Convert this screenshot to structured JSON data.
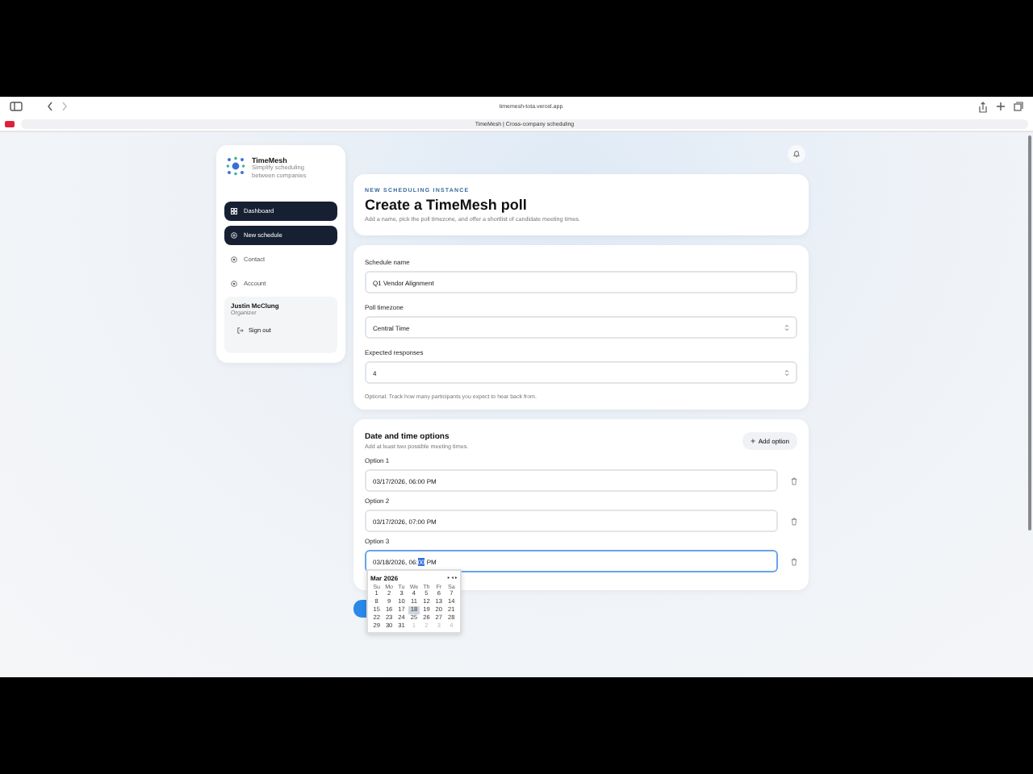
{
  "browser": {
    "url": "timemesh-tota.vercel.app",
    "tab_title": "TimeMesh | Cross-company scheduling"
  },
  "sidebar": {
    "brand": "TimeMesh",
    "tagline": "Simplify scheduling between companies",
    "items": [
      {
        "label": "Dashboard",
        "selected": true,
        "kind": "grid"
      },
      {
        "label": "New schedule",
        "selected": true,
        "kind": "plus"
      },
      {
        "label": "Contact",
        "selected": false,
        "kind": "circle"
      },
      {
        "label": "Account",
        "selected": false,
        "kind": "circle"
      }
    ],
    "user": {
      "name": "Justin McClung",
      "role": "Organizer",
      "sign_out": "Sign out"
    }
  },
  "header": {
    "eyebrow": "NEW SCHEDULING INSTANCE",
    "title": "Create a TimeMesh poll",
    "description": "Add a name, pick the poll timezone, and offer a shortlist of candidate meeting times."
  },
  "form": {
    "fields": [
      {
        "label": "Schedule name",
        "value": "Q1 Vendor Alignment",
        "kind": "text"
      },
      {
        "label": "Poll timezone",
        "value": "Central Time",
        "kind": "select"
      },
      {
        "label": "Expected responses",
        "value": "4",
        "kind": "number"
      }
    ],
    "hint": "Optional. Track how many participants you expect to hear back from."
  },
  "dates": {
    "title": "Date and time options",
    "subtitle": "Add at least two possible meeting times.",
    "add_label": "Add option",
    "options": [
      {
        "label": "Option 1",
        "focused": false,
        "segments": [
          {
            "text": "03/17/2026, 06:00 PM",
            "selected": false
          }
        ]
      },
      {
        "label": "Option 2",
        "focused": false,
        "segments": [
          {
            "text": "03/17/2026, 07:00 PM",
            "selected": false
          }
        ]
      },
      {
        "label": "Option 3",
        "focused": true,
        "segments": [
          {
            "text": "03/18/2026, 06:",
            "selected": false
          },
          {
            "text": "00",
            "selected": true
          },
          {
            "text": " PM",
            "selected": false
          }
        ]
      }
    ]
  },
  "picker": {
    "month": "Mar 2026",
    "weekdays": [
      "Su",
      "Mo",
      "Tu",
      "We",
      "Th",
      "Fr",
      "Sa"
    ],
    "days": [
      {
        "label": "1",
        "selected": false,
        "muted": false
      },
      {
        "label": "2",
        "selected": false,
        "muted": false
      },
      {
        "label": "3",
        "selected": false,
        "muted": false
      },
      {
        "label": "4",
        "selected": false,
        "muted": false
      },
      {
        "label": "5",
        "selected": false,
        "muted": false
      },
      {
        "label": "6",
        "selected": false,
        "muted": false
      },
      {
        "label": "7",
        "selected": false,
        "muted": false
      },
      {
        "label": "8",
        "selected": false,
        "muted": false
      },
      {
        "label": "9",
        "selected": false,
        "muted": false
      },
      {
        "label": "10",
        "selected": false,
        "muted": false
      },
      {
        "label": "11",
        "selected": false,
        "muted": false
      },
      {
        "label": "12",
        "selected": false,
        "muted": false
      },
      {
        "label": "13",
        "selected": false,
        "muted": false
      },
      {
        "label": "14",
        "selected": false,
        "muted": false
      },
      {
        "label": "15",
        "selected": false,
        "muted": false
      },
      {
        "label": "16",
        "selected": false,
        "muted": false
      },
      {
        "label": "17",
        "selected": false,
        "muted": false
      },
      {
        "label": "18",
        "selected": true,
        "muted": false
      },
      {
        "label": "19",
        "selected": false,
        "muted": false
      },
      {
        "label": "20",
        "selected": false,
        "muted": false
      },
      {
        "label": "21",
        "selected": false,
        "muted": false
      },
      {
        "label": "22",
        "selected": false,
        "muted": false
      },
      {
        "label": "23",
        "selected": false,
        "muted": false
      },
      {
        "label": "24",
        "selected": false,
        "muted": false
      },
      {
        "label": "25",
        "selected": false,
        "muted": false
      },
      {
        "label": "26",
        "selected": false,
        "muted": false
      },
      {
        "label": "27",
        "selected": false,
        "muted": false
      },
      {
        "label": "28",
        "selected": false,
        "muted": false
      },
      {
        "label": "29",
        "selected": false,
        "muted": false
      },
      {
        "label": "30",
        "selected": false,
        "muted": false
      },
      {
        "label": "31",
        "selected": false,
        "muted": false
      },
      {
        "label": "1",
        "selected": false,
        "muted": true
      },
      {
        "label": "2",
        "selected": false,
        "muted": true
      },
      {
        "label": "3",
        "selected": false,
        "muted": true
      },
      {
        "label": "4",
        "selected": false,
        "muted": true
      }
    ]
  }
}
